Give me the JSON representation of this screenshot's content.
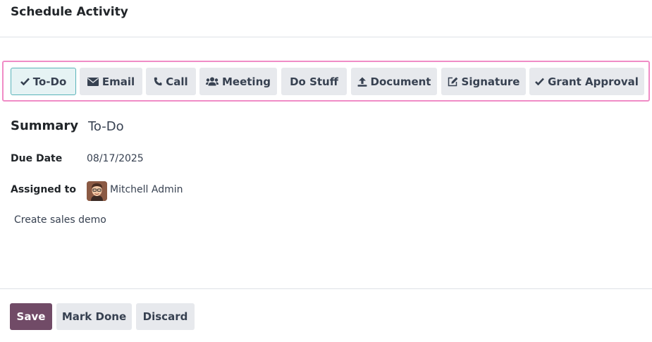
{
  "dialog": {
    "title": "Schedule Activity"
  },
  "activity_types": [
    {
      "label": "To-Do",
      "icon": "check-icon",
      "active": true
    },
    {
      "label": "Email",
      "icon": "envelope-icon",
      "active": false
    },
    {
      "label": "Call",
      "icon": "phone-icon",
      "active": false
    },
    {
      "label": "Meeting",
      "icon": "users-icon",
      "active": false
    },
    {
      "label": "Do Stuff",
      "icon": "",
      "active": false
    },
    {
      "label": "Document",
      "icon": "upload-icon",
      "active": false
    },
    {
      "label": "Signature",
      "icon": "pencil-square-icon",
      "active": false
    },
    {
      "label": "Grant Approval",
      "icon": "check-icon",
      "active": false
    }
  ],
  "form": {
    "summary_label": "Summary",
    "summary_value": "To-Do",
    "due_date_label": "Due Date",
    "due_date_value": "08/17/2025",
    "assigned_label": "Assigned to",
    "assigned_value": "Mitchell Admin",
    "note": "Create sales demo"
  },
  "footer": {
    "save_label": "Save",
    "mark_done_label": "Mark Done",
    "discard_label": "Discard"
  },
  "colors": {
    "primary": "#714b67",
    "highlight_border": "#f08cc6",
    "active_border": "#5ab4ba",
    "active_background": "#e6f3f4",
    "button_background": "#e7e9ed"
  }
}
